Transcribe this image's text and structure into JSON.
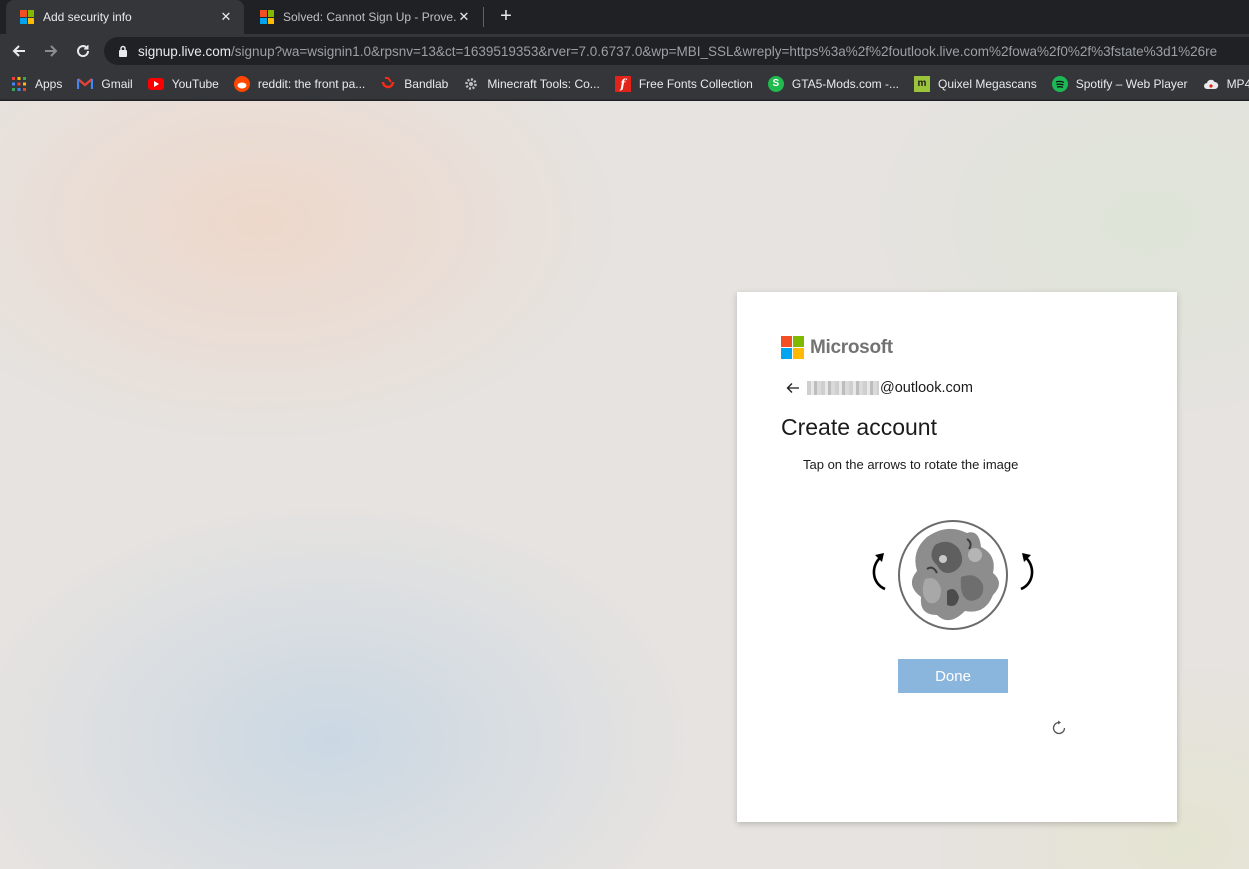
{
  "browser": {
    "tabs": [
      {
        "title": "Add security info",
        "active": true
      },
      {
        "title": "Solved: Cannot Sign Up - Prove. \\",
        "active": false
      }
    ],
    "url_host": "signup.live.com",
    "url_rest": "/signup?wa=wsignin1.0&rpsnv=13&ct=1639519353&rver=7.0.6737.0&wp=MBI_SSL&wreply=https%3a%2f%2foutlook.live.com%2fowa%2f0%2f%3fstate%3d1%26re",
    "bookmarks": [
      {
        "label": "Apps",
        "icon": "apps-grid-icon"
      },
      {
        "label": "Gmail",
        "icon": "gmail-icon",
        "color": "#ea4335"
      },
      {
        "label": "YouTube",
        "icon": "youtube-icon",
        "color": "#ff0000"
      },
      {
        "label": "reddit: the front pa...",
        "icon": "reddit-icon",
        "color": "#ff4500"
      },
      {
        "label": "Bandlab",
        "icon": "bandlab-icon",
        "color": "#f12c18"
      },
      {
        "label": "Minecraft Tools: Co...",
        "icon": "gear-icon",
        "color": "#9aa0a6"
      },
      {
        "label": "Free Fonts Collection",
        "icon": "fonts-icon",
        "color": "#e2231a"
      },
      {
        "label": "GTA5-Mods.com -...",
        "icon": "gta5mods-icon",
        "color": "#20ba4e"
      },
      {
        "label": "Quixel Megascans",
        "icon": "quixel-icon",
        "color": "#9bc43c"
      },
      {
        "label": "Spotify – Web Player",
        "icon": "spotify-icon",
        "color": "#1db954"
      },
      {
        "label": "MP4",
        "icon": "cloud-icon",
        "color": "#e8eaed"
      }
    ]
  },
  "card": {
    "brand": "Microsoft",
    "email_suffix": "@outlook.com",
    "title": "Create account",
    "instruction": "Tap on the arrows to rotate the image",
    "done_label": "Done"
  },
  "colors": {
    "ms_red": "#f25022",
    "ms_green": "#7fba00",
    "ms_blue": "#00a4ef",
    "ms_yellow": "#ffb900",
    "done_button": "#8ab6dd"
  }
}
